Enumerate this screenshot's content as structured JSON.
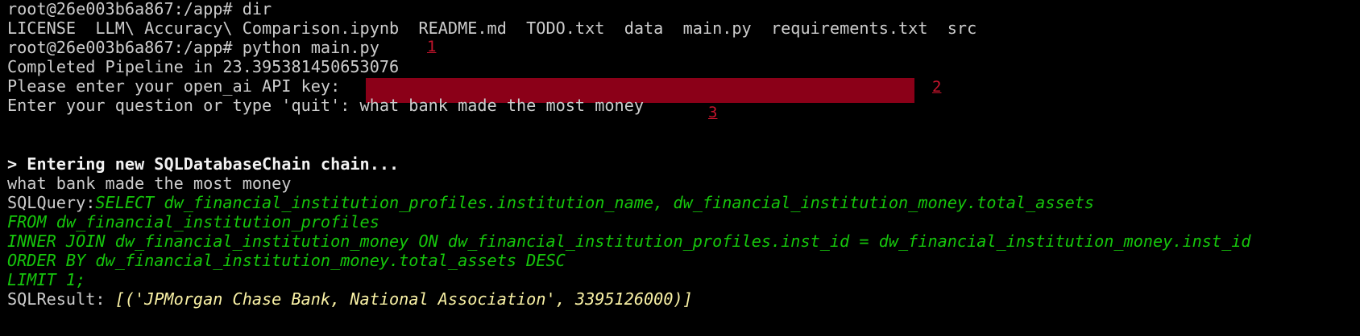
{
  "terminal": {
    "lines": {
      "l1": "root@26e003b6a867:/app# dir",
      "l2": "LICENSE  LLM\\ Accuracy\\ Comparison.ipynb  README.md  TODO.txt  data  main.py  requirements.txt  src",
      "l3": "root@26e003b6a867:/app# python main.py",
      "l4": "Completed Pipeline in 23.395381450653076",
      "l5": "Please enter your open_ai API key:",
      "l6": "Enter your question or type 'quit': what bank made the most money",
      "l7": "> Entering new SQLDatabaseChain chain...",
      "l8": "what bank made the most money",
      "l9_prefix": "SQLQuery:",
      "l9_sql": "SELECT dw_financial_institution_profiles.institution_name, dw_financial_institution_money.total_assets",
      "l10": "FROM dw_financial_institution_profiles",
      "l11": "INNER JOIN dw_financial_institution_money ON dw_financial_institution_profiles.inst_id = dw_financial_institution_money.inst_id",
      "l12": "ORDER BY dw_financial_institution_money.total_assets DESC",
      "l13": "LIMIT 1;",
      "l14_prefix": "SQLResult: ",
      "l14_result": "[('JPMorgan Chase Bank, National Association', 3395126000)]"
    },
    "markers": {
      "m1": "1",
      "m2": "2",
      "m3": "3"
    },
    "colors": {
      "background": "#000000",
      "text": "#cccccc",
      "sql": "#16c60c",
      "result": "#f9f1a5",
      "redaction": "#8b0018",
      "marker": "#c4142c"
    }
  }
}
